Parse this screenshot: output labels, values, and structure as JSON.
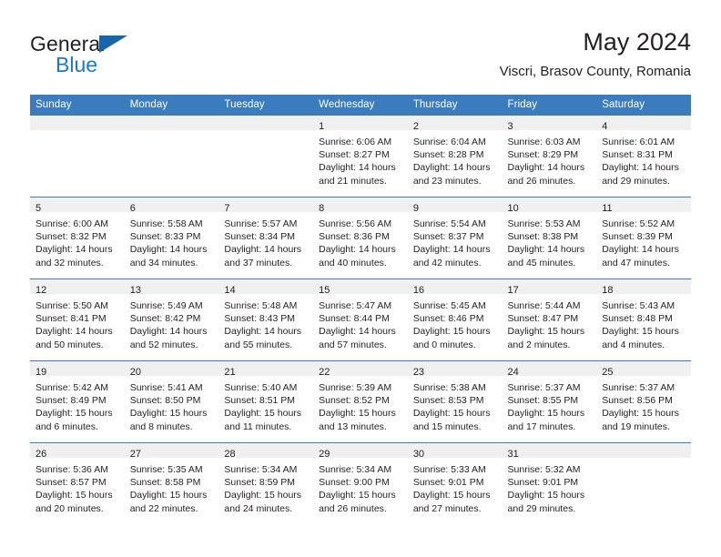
{
  "brand": {
    "line1": "General",
    "line2": "Blue",
    "logo_icon": "triangle-flag-icon"
  },
  "header": {
    "title": "May 2024",
    "subtitle": "Viscri, Brasov County, Romania"
  },
  "theme": {
    "header_blue": "#3a7cbe",
    "brand_blue": "#1b79c9",
    "daystrip_gray": "#f0f0f0",
    "text": "#231f20"
  },
  "calendar": {
    "weekday_headers": [
      "Sunday",
      "Monday",
      "Tuesday",
      "Wednesday",
      "Thursday",
      "Friday",
      "Saturday"
    ],
    "weeks": [
      [
        {
          "day": "",
          "lines": []
        },
        {
          "day": "",
          "lines": []
        },
        {
          "day": "",
          "lines": []
        },
        {
          "day": "1",
          "lines": [
            "Sunrise: 6:06 AM",
            "Sunset: 8:27 PM",
            "Daylight: 14 hours",
            "and 21 minutes."
          ]
        },
        {
          "day": "2",
          "lines": [
            "Sunrise: 6:04 AM",
            "Sunset: 8:28 PM",
            "Daylight: 14 hours",
            "and 23 minutes."
          ]
        },
        {
          "day": "3",
          "lines": [
            "Sunrise: 6:03 AM",
            "Sunset: 8:29 PM",
            "Daylight: 14 hours",
            "and 26 minutes."
          ]
        },
        {
          "day": "4",
          "lines": [
            "Sunrise: 6:01 AM",
            "Sunset: 8:31 PM",
            "Daylight: 14 hours",
            "and 29 minutes."
          ]
        }
      ],
      [
        {
          "day": "5",
          "lines": [
            "Sunrise: 6:00 AM",
            "Sunset: 8:32 PM",
            "Daylight: 14 hours",
            "and 32 minutes."
          ]
        },
        {
          "day": "6",
          "lines": [
            "Sunrise: 5:58 AM",
            "Sunset: 8:33 PM",
            "Daylight: 14 hours",
            "and 34 minutes."
          ]
        },
        {
          "day": "7",
          "lines": [
            "Sunrise: 5:57 AM",
            "Sunset: 8:34 PM",
            "Daylight: 14 hours",
            "and 37 minutes."
          ]
        },
        {
          "day": "8",
          "lines": [
            "Sunrise: 5:56 AM",
            "Sunset: 8:36 PM",
            "Daylight: 14 hours",
            "and 40 minutes."
          ]
        },
        {
          "day": "9",
          "lines": [
            "Sunrise: 5:54 AM",
            "Sunset: 8:37 PM",
            "Daylight: 14 hours",
            "and 42 minutes."
          ]
        },
        {
          "day": "10",
          "lines": [
            "Sunrise: 5:53 AM",
            "Sunset: 8:38 PM",
            "Daylight: 14 hours",
            "and 45 minutes."
          ]
        },
        {
          "day": "11",
          "lines": [
            "Sunrise: 5:52 AM",
            "Sunset: 8:39 PM",
            "Daylight: 14 hours",
            "and 47 minutes."
          ]
        }
      ],
      [
        {
          "day": "12",
          "lines": [
            "Sunrise: 5:50 AM",
            "Sunset: 8:41 PM",
            "Daylight: 14 hours",
            "and 50 minutes."
          ]
        },
        {
          "day": "13",
          "lines": [
            "Sunrise: 5:49 AM",
            "Sunset: 8:42 PM",
            "Daylight: 14 hours",
            "and 52 minutes."
          ]
        },
        {
          "day": "14",
          "lines": [
            "Sunrise: 5:48 AM",
            "Sunset: 8:43 PM",
            "Daylight: 14 hours",
            "and 55 minutes."
          ]
        },
        {
          "day": "15",
          "lines": [
            "Sunrise: 5:47 AM",
            "Sunset: 8:44 PM",
            "Daylight: 14 hours",
            "and 57 minutes."
          ]
        },
        {
          "day": "16",
          "lines": [
            "Sunrise: 5:45 AM",
            "Sunset: 8:46 PM",
            "Daylight: 15 hours",
            "and 0 minutes."
          ]
        },
        {
          "day": "17",
          "lines": [
            "Sunrise: 5:44 AM",
            "Sunset: 8:47 PM",
            "Daylight: 15 hours",
            "and 2 minutes."
          ]
        },
        {
          "day": "18",
          "lines": [
            "Sunrise: 5:43 AM",
            "Sunset: 8:48 PM",
            "Daylight: 15 hours",
            "and 4 minutes."
          ]
        }
      ],
      [
        {
          "day": "19",
          "lines": [
            "Sunrise: 5:42 AM",
            "Sunset: 8:49 PM",
            "Daylight: 15 hours",
            "and 6 minutes."
          ]
        },
        {
          "day": "20",
          "lines": [
            "Sunrise: 5:41 AM",
            "Sunset: 8:50 PM",
            "Daylight: 15 hours",
            "and 8 minutes."
          ]
        },
        {
          "day": "21",
          "lines": [
            "Sunrise: 5:40 AM",
            "Sunset: 8:51 PM",
            "Daylight: 15 hours",
            "and 11 minutes."
          ]
        },
        {
          "day": "22",
          "lines": [
            "Sunrise: 5:39 AM",
            "Sunset: 8:52 PM",
            "Daylight: 15 hours",
            "and 13 minutes."
          ]
        },
        {
          "day": "23",
          "lines": [
            "Sunrise: 5:38 AM",
            "Sunset: 8:53 PM",
            "Daylight: 15 hours",
            "and 15 minutes."
          ]
        },
        {
          "day": "24",
          "lines": [
            "Sunrise: 5:37 AM",
            "Sunset: 8:55 PM",
            "Daylight: 15 hours",
            "and 17 minutes."
          ]
        },
        {
          "day": "25",
          "lines": [
            "Sunrise: 5:37 AM",
            "Sunset: 8:56 PM",
            "Daylight: 15 hours",
            "and 19 minutes."
          ]
        }
      ],
      [
        {
          "day": "26",
          "lines": [
            "Sunrise: 5:36 AM",
            "Sunset: 8:57 PM",
            "Daylight: 15 hours",
            "and 20 minutes."
          ]
        },
        {
          "day": "27",
          "lines": [
            "Sunrise: 5:35 AM",
            "Sunset: 8:58 PM",
            "Daylight: 15 hours",
            "and 22 minutes."
          ]
        },
        {
          "day": "28",
          "lines": [
            "Sunrise: 5:34 AM",
            "Sunset: 8:59 PM",
            "Daylight: 15 hours",
            "and 24 minutes."
          ]
        },
        {
          "day": "29",
          "lines": [
            "Sunrise: 5:34 AM",
            "Sunset: 9:00 PM",
            "Daylight: 15 hours",
            "and 26 minutes."
          ]
        },
        {
          "day": "30",
          "lines": [
            "Sunrise: 5:33 AM",
            "Sunset: 9:01 PM",
            "Daylight: 15 hours",
            "and 27 minutes."
          ]
        },
        {
          "day": "31",
          "lines": [
            "Sunrise: 5:32 AM",
            "Sunset: 9:01 PM",
            "Daylight: 15 hours",
            "and 29 minutes."
          ]
        },
        {
          "day": "",
          "lines": []
        }
      ]
    ]
  }
}
